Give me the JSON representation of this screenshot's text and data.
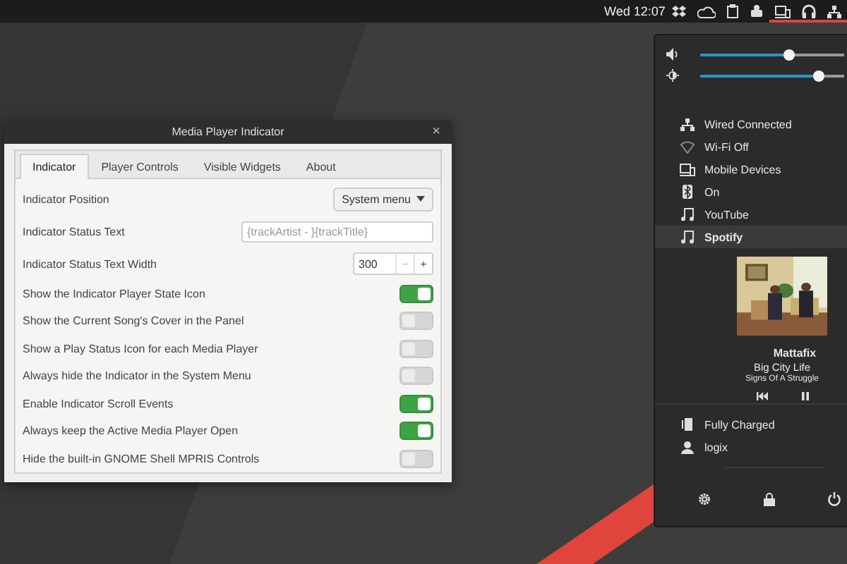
{
  "top_bar": {
    "clock": "Wed 12:07"
  },
  "dialog": {
    "title": "Media Player Indicator",
    "close": "×",
    "tabs": [
      {
        "label": "Indicator",
        "selected": true
      },
      {
        "label": "Player Controls",
        "selected": false
      },
      {
        "label": "Visible Widgets",
        "selected": false
      },
      {
        "label": "About",
        "selected": false
      }
    ],
    "settings": [
      {
        "kind": "dropdown",
        "label": "Indicator Position",
        "value": "System menu"
      },
      {
        "kind": "entry",
        "label": "Indicator Status Text",
        "placeholder": "{trackArtist - }{trackTitle}"
      },
      {
        "kind": "spin",
        "label": "Indicator Status Text Width",
        "value": "300",
        "minus": "−",
        "plus": "+"
      },
      {
        "kind": "switch",
        "label": "Show the Indicator Player State Icon",
        "on": true
      },
      {
        "kind": "switch",
        "label": "Show the Current Song's Cover in the Panel",
        "on": false
      },
      {
        "kind": "switch",
        "label": "Show a Play Status Icon for each Media Player",
        "on": false
      },
      {
        "kind": "switch",
        "label": "Always hide the Indicator in the System Menu",
        "on": false
      },
      {
        "kind": "switch",
        "label": "Enable Indicator Scroll Events",
        "on": true
      },
      {
        "kind": "switch",
        "label": "Always keep the Active Media Player Open",
        "on": true
      },
      {
        "kind": "switch",
        "label": "Hide the built-in GNOME Shell MPRIS Controls",
        "on": false
      }
    ]
  },
  "menu": {
    "sliders": [
      {
        "kind": "volume",
        "level": 0.62
      },
      {
        "kind": "brightness",
        "level": 0.82
      }
    ],
    "items": [
      {
        "kind": "wired",
        "label": "Wired Connected",
        "selected": false
      },
      {
        "kind": "wifi",
        "label": "Wi-Fi Off",
        "selected": false
      },
      {
        "kind": "mobile",
        "label": "Mobile Devices",
        "selected": false
      },
      {
        "kind": "bluetooth",
        "label": "On",
        "selected": false
      },
      {
        "kind": "player",
        "label": "YouTube",
        "selected": false
      },
      {
        "kind": "player",
        "label": "Spotify",
        "selected": true
      }
    ],
    "player": {
      "artist": "Mattafix",
      "title": "Big City Life",
      "album": "Signs Of A Struggle"
    },
    "status": [
      {
        "kind": "battery",
        "label": "Fully Charged"
      },
      {
        "kind": "user",
        "label": "logix"
      }
    ]
  }
}
